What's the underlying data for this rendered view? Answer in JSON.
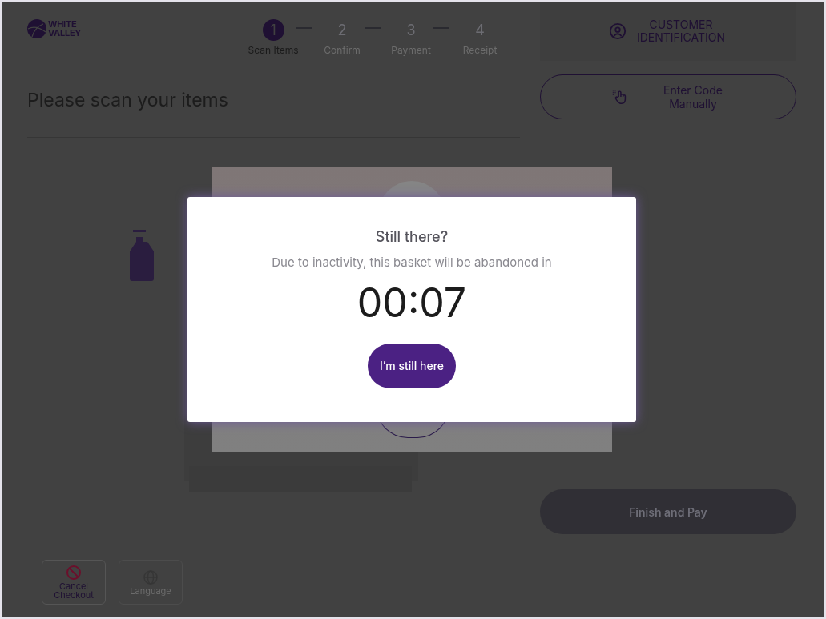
{
  "logo": {
    "line1": "WHITE",
    "line2": "VALLEY"
  },
  "steps": [
    {
      "number": "1",
      "label": "Scan Items",
      "selected": true
    },
    {
      "number": "2",
      "label": "Confirm",
      "selected": false
    },
    {
      "number": "3",
      "label": "Payment",
      "selected": false
    },
    {
      "number": "4",
      "label": "Receipt",
      "selected": false
    }
  ],
  "heading": "Please scan your items",
  "customer_button": {
    "label": "CUSTOMER IDENTIFICATION"
  },
  "enter_code_button": {
    "label": "Enter Code Manually"
  },
  "finish_button": {
    "label": "Finish and Pay",
    "disabled": true
  },
  "footer_buttons": [
    {
      "kind": "cancel",
      "label": "Cancel Checkout",
      "disabled": false
    },
    {
      "kind": "language",
      "label": "Language",
      "disabled": true
    }
  ],
  "dialog": {
    "title": "Still there?",
    "message": "Due to inactivity, this basket will be abandoned in",
    "countdown": "00:07",
    "button": "I’m still here"
  }
}
